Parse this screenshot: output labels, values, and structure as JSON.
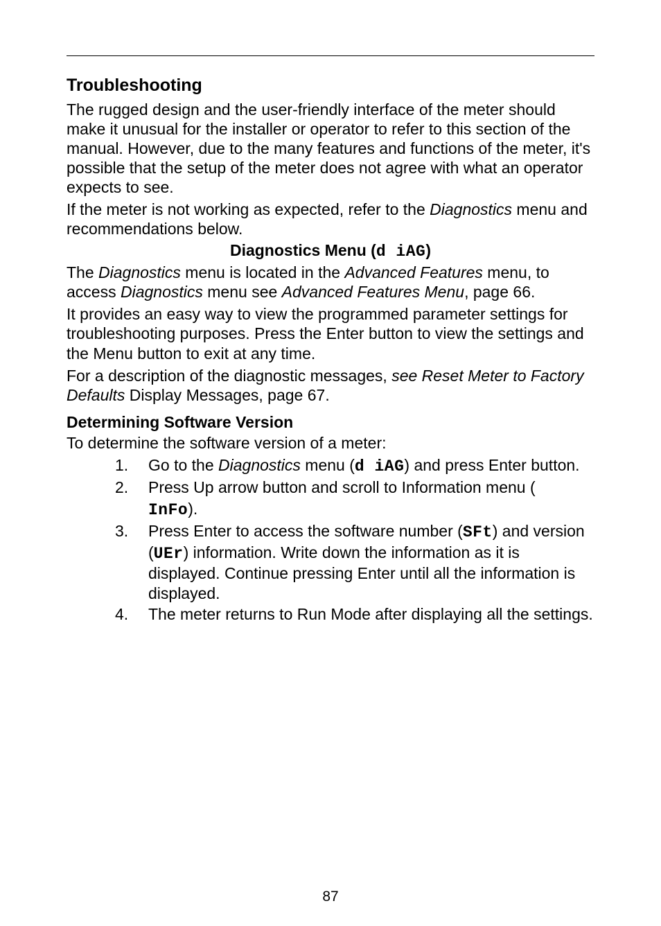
{
  "section_heading": "Troubleshooting",
  "para1": "The rugged design and the user-friendly interface of the meter should make it unusual for the installer or operator to refer to this section of the manual. However, due to the many features and functions of the meter, it's possible that the setup of the meter does not agree with what an operator expects to see.",
  "para2_a": "If the meter is not working as expected, refer to the ",
  "para2_i": "Diagnostics",
  "para2_b": " menu and recommendations below.",
  "diag_heading_a": "Diagnostics Menu (",
  "diag_heading_seg": "d iAG",
  "diag_heading_b": ")",
  "para3_a": "The ",
  "para3_i1": "Diagnostics",
  "para3_b": " menu is located in the ",
  "para3_i2": "Advanced Features",
  "para3_c": " menu, to access ",
  "para3_i3": "Diagnostics",
  "para3_d": " menu see ",
  "para3_i4": "Advanced Features Menu",
  "para3_e": ", page 66.",
  "para4": "It provides an easy way to view the programmed parameter settings for troubleshooting purposes. Press the Enter button to view the settings and the Menu button to exit at any time.",
  "para5_a": "For a description of the diagnostic messages, ",
  "para5_i": "see Reset Meter to Factory Defaults",
  "para5_b": " Display Messages, page 67.",
  "subheading": "Determining Software Version",
  "para6": "To determine the software version of a meter:",
  "step1_a": "Go to the ",
  "step1_i": "Diagnostics",
  "step1_b": " menu (",
  "step1_seg": "d iAG",
  "step1_c": ") and press Enter button.",
  "step2_a": "Press Up arrow button and scroll to Information menu (",
  "step2_seg": " InFo",
  "step2_b": ").",
  "step3_a": "Press Enter to access the software number (",
  "step3_seg1": "SFt",
  "step3_b": ") and version (",
  "step3_seg2": "UEr",
  "step3_c": ") information. Write down the information as it is displayed. Continue pressing Enter until all the information is displayed.",
  "step4": "The meter returns to Run Mode after displaying all the settings.",
  "num1": "1.",
  "num2": "2.",
  "num3": "3.",
  "num4": "4.",
  "page_number": "87"
}
